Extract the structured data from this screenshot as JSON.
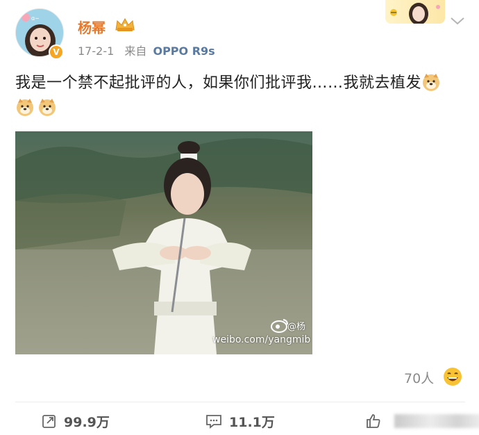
{
  "post": {
    "author": "杨幂",
    "date": "17-2-1",
    "source_prefix": "来自",
    "device": "OPPO R9s",
    "text": "我是一个禁不起批评的人，如果你们批评我……我就去植发",
    "emoji_count": 3,
    "emoji_name": "doge-emoji"
  },
  "photo": {
    "watermark_url": "weibo.com/yangmib",
    "watermark_handle": "@杨"
  },
  "reactions": {
    "likes_text": "70人",
    "emoji": "laughing-emoji"
  },
  "actions": {
    "repost_count": "99.9万",
    "comment_count": "11.1万"
  },
  "colors": {
    "username": "#e8792a",
    "badge": "#f6a623",
    "device": "#5a7aa0",
    "muted": "#8a8a8a"
  }
}
